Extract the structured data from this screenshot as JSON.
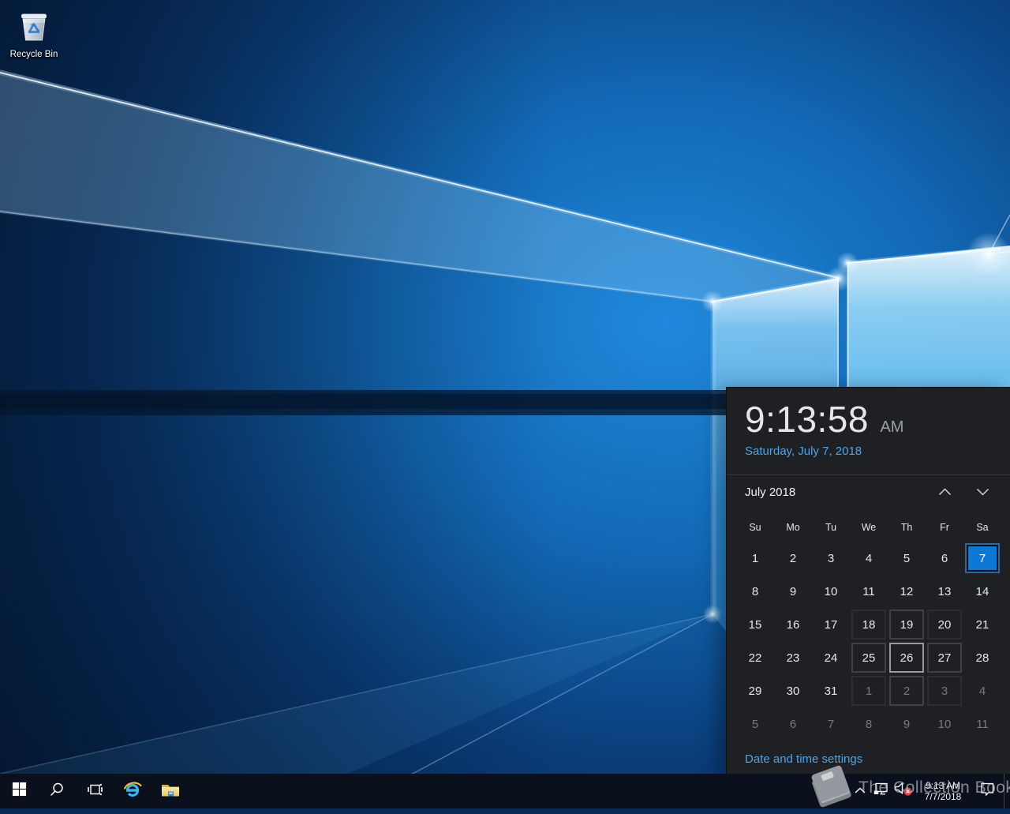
{
  "accent_color": "#0078d7",
  "link_color": "#4fa3e8",
  "desktop": {
    "recycle_bin": {
      "label": "Recycle Bin",
      "icon": "recycle-bin-icon"
    }
  },
  "clock_flyout": {
    "time": "9:13:58",
    "meridiem": "AM",
    "date": "Saturday, July 7, 2018",
    "calendar": {
      "month_label": "July 2018",
      "prev_icon": "chevron-up-icon",
      "next_icon": "chevron-down-icon",
      "day_headers": [
        "Su",
        "Mo",
        "Tu",
        "We",
        "Th",
        "Fr",
        "Sa"
      ],
      "cells": [
        {
          "d": "1"
        },
        {
          "d": "2"
        },
        {
          "d": "3"
        },
        {
          "d": "4"
        },
        {
          "d": "5"
        },
        {
          "d": "6"
        },
        {
          "d": "7",
          "s": "selected"
        },
        {
          "d": "8"
        },
        {
          "d": "9"
        },
        {
          "d": "10"
        },
        {
          "d": "11"
        },
        {
          "d": "12"
        },
        {
          "d": "13"
        },
        {
          "d": "14"
        },
        {
          "d": "15"
        },
        {
          "d": "16"
        },
        {
          "d": "17"
        },
        {
          "d": "18",
          "s": "f2"
        },
        {
          "d": "19",
          "s": "f1"
        },
        {
          "d": "20",
          "s": "f2"
        },
        {
          "d": "21"
        },
        {
          "d": "22"
        },
        {
          "d": "23"
        },
        {
          "d": "24"
        },
        {
          "d": "25",
          "s": "f1"
        },
        {
          "d": "26",
          "s": "hover"
        },
        {
          "d": "27",
          "s": "f1"
        },
        {
          "d": "28"
        },
        {
          "d": "29"
        },
        {
          "d": "30"
        },
        {
          "d": "31"
        },
        {
          "d": "1",
          "m": 1,
          "s": "f2"
        },
        {
          "d": "2",
          "m": 1,
          "s": "f1"
        },
        {
          "d": "3",
          "m": 1,
          "s": "f2"
        },
        {
          "d": "4",
          "m": 1
        },
        {
          "d": "5",
          "m": 1
        },
        {
          "d": "6",
          "m": 1
        },
        {
          "d": "7",
          "m": 1
        },
        {
          "d": "8",
          "m": 1
        },
        {
          "d": "9",
          "m": 1
        },
        {
          "d": "10",
          "m": 1
        },
        {
          "d": "11",
          "m": 1
        }
      ]
    },
    "settings_link": "Date and time settings"
  },
  "taskbar": {
    "start": {
      "icon": "windows-logo-icon"
    },
    "search": {
      "icon": "search-icon"
    },
    "task_view": {
      "icon": "task-view-icon"
    },
    "internet_explorer": {
      "icon": "internet-explorer-icon"
    },
    "file_explorer": {
      "icon": "folder-icon"
    },
    "tray": {
      "hidden_icons": {
        "icon": "chevron-up-icon"
      },
      "network": {
        "icon": "ethernet-network-icon"
      },
      "volume": {
        "icon": "speaker-muted-icon"
      },
      "clock": {
        "time": "9:13 AM",
        "date": "7/7/2018"
      },
      "action_center": {
        "icon": "action-center-icon"
      }
    }
  },
  "watermark": {
    "text": "The Collection Book",
    "icon": "book-icon"
  }
}
